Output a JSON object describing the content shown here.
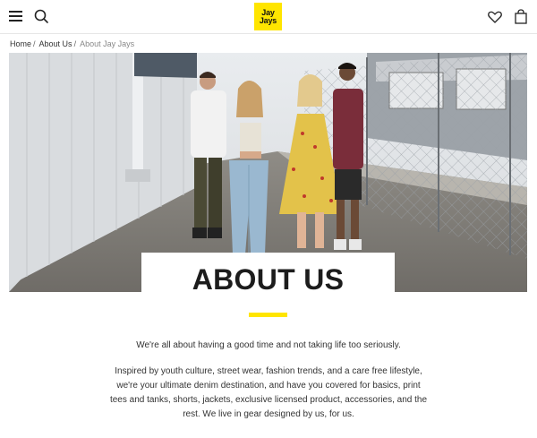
{
  "header": {
    "menu_icon": "hamburger-menu-icon",
    "search_icon": "search-icon",
    "logo": {
      "line1": "Jay",
      "line2": "Jays"
    },
    "wishlist_icon": "heart-icon",
    "bag_icon": "shopping-bag-icon"
  },
  "breadcrumb": {
    "items": [
      "Home",
      "About Us"
    ],
    "separator": "/",
    "current": "About Jay Jays"
  },
  "hero": {
    "image_alt": "Four friends walking together beside a white wall and chain-link fence"
  },
  "page": {
    "title": "ABOUT US",
    "intro": "We're all about having a good time and not taking life too seriously.",
    "body": "Inspired by youth culture, street wear, fashion trends, and a care free lifestyle, we're your ultimate denim destination, and have you covered for basics, print tees and tanks, shorts, jackets, exclusive licensed product, accessories, and the rest. We live in gear designed by us, for us."
  },
  "colors": {
    "brand_yellow": "#ffe500",
    "text": "#333333",
    "title": "#1c1c1c"
  }
}
